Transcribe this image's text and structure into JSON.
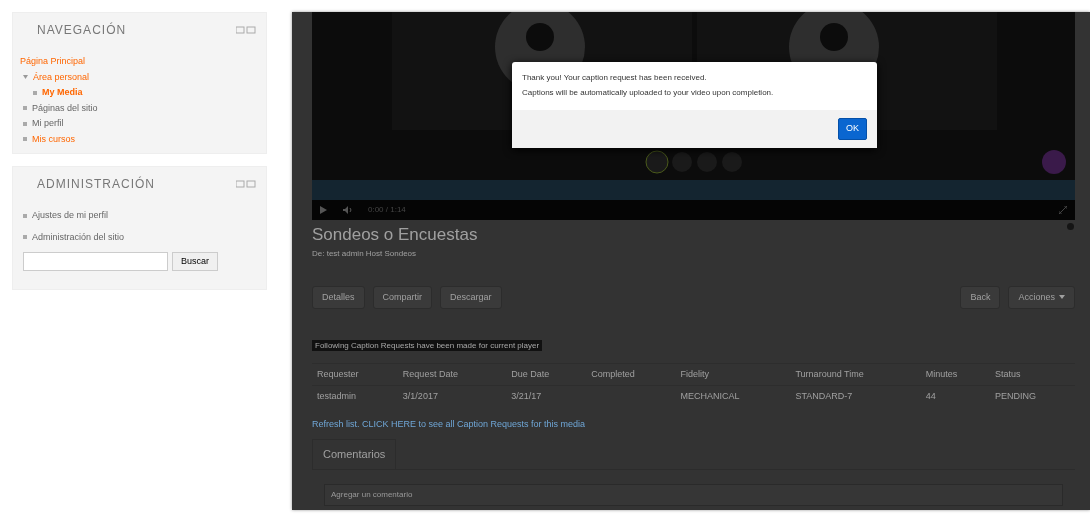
{
  "navigation": {
    "title": "NAVEGACIÓN",
    "items": [
      {
        "label": "Página Principal",
        "link": true,
        "bold": false
      },
      {
        "label": "Área personal",
        "link": true,
        "bold": false,
        "expanded": true,
        "children": [
          {
            "label": "My Media",
            "link": true,
            "bold": true
          }
        ]
      },
      {
        "label": "Páginas del sitio",
        "link": false,
        "bold": false,
        "expanded": false
      },
      {
        "label": "Mi perfil",
        "link": false,
        "bold": false,
        "expanded": false
      },
      {
        "label": "Mis cursos",
        "link": true,
        "bold": false,
        "expanded": false
      }
    ]
  },
  "administration": {
    "title": "ADMINISTRACIÓN",
    "items": [
      {
        "label": "Ajustes de mi perfil"
      },
      {
        "label": "Administración del sitio"
      }
    ],
    "search_button": "Buscar"
  },
  "video": {
    "time": "0:00 / 1:14"
  },
  "media": {
    "title": "Sondeos o Encuestas",
    "subtitle": "De: test admin Host Sondeos",
    "buttons": [
      "Detalles",
      "Compartir",
      "Descargar"
    ],
    "right_buttons": [
      "Back",
      "Acciones"
    ],
    "notice": "Following Caption Requests have been made for current player",
    "table": {
      "columns": [
        "Requester",
        "Request Date",
        "Due Date",
        "Completed",
        "Fidelity",
        "Turnaround Time",
        "Minutes",
        "Status"
      ],
      "rows": [
        [
          "testadmin",
          "3/1/2017",
          "3/21/17",
          "",
          "MECHANICAL",
          "STANDARD-7",
          "44",
          "PENDING"
        ]
      ]
    },
    "refresh_link": "Refresh list. CLICK HERE to see all Caption Requests for this media",
    "comments_tab": "Comentarios",
    "comment_placeholder": "Agregar un comentario"
  },
  "dialog": {
    "lines": [
      "Thank you! Your caption request has been received.",
      "Captions will be automatically uploaded to your video upon completion."
    ],
    "button": "OK"
  }
}
